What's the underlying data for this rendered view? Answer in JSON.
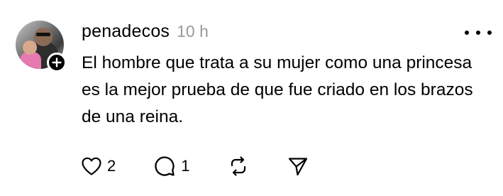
{
  "post": {
    "username": "penadecos",
    "time": "10 h",
    "text": "El hombre que trata a su mujer como una princesa es la mejor prueba de que fue criado en los brazos de una reina.",
    "likes": "2",
    "replies": "1"
  },
  "icons": {
    "follow": "plus-icon",
    "more": "more-horizontal-icon",
    "like": "heart-icon",
    "reply": "comment-icon",
    "repost": "repost-icon",
    "share": "send-icon"
  }
}
